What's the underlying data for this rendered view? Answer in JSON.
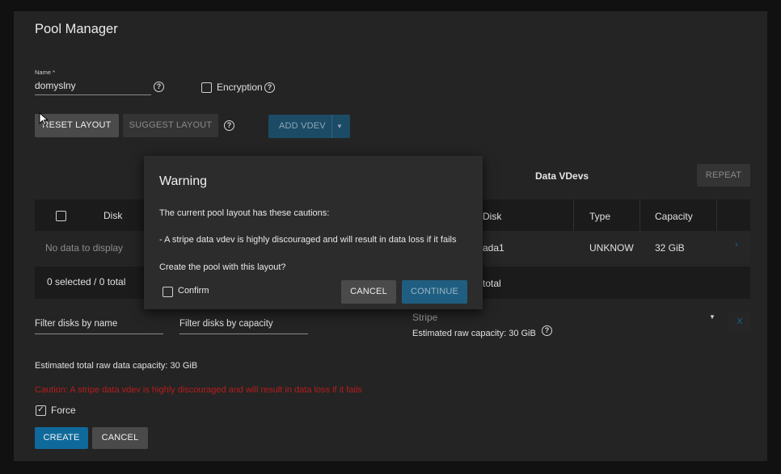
{
  "page": {
    "title": "Pool Manager"
  },
  "name_field": {
    "label": "Name *",
    "value": "domyslny"
  },
  "encryption": {
    "label": "Encryption"
  },
  "toolbar": {
    "reset_layout": "RESET LAYOUT",
    "suggest_layout": "SUGGEST LAYOUT",
    "add_vdev": "ADD VDEV"
  },
  "available_disks": {
    "column_header": "Disk",
    "empty_text": "No data to display",
    "footer": "0 selected / 0 total",
    "filter_name_placeholder": "Filter disks by name",
    "filter_capacity_placeholder": "Filter disks by capacity"
  },
  "data_vdevs": {
    "title": "Data VDevs",
    "repeat_label": "REPEAT",
    "columns": [
      "Disk",
      "Type",
      "Capacity"
    ],
    "rows": [
      {
        "disk": "ada1",
        "type": "UNKNOW",
        "capacity": "32 GiB"
      }
    ],
    "footer": "total",
    "layout_value": "Stripe",
    "estimated_capacity": "Estimated raw capacity: 30 GiB",
    "remove_label": "X"
  },
  "summary": {
    "estimated_total": "Estimated total raw data capacity: 30 GiB",
    "caution": "Caution: A stripe data vdev is highly discouraged and will result in data loss if it fails",
    "force_label": "Force",
    "force_checked": true
  },
  "actions": {
    "create": "CREATE",
    "cancel": "CANCEL"
  },
  "dialog": {
    "title": "Warning",
    "line1": "The current pool layout has these cautions:",
    "line2": "- A stripe data vdev is highly discouraged and will result in data loss if it fails",
    "line3": "Create the pool with this layout?",
    "confirm_label": "Confirm",
    "cancel": "CANCEL",
    "continue": "CONTINUE"
  },
  "colors": {
    "background": "#111111",
    "card": "#242424",
    "accent_blue": "#0f6a9b",
    "caution_red": "#b71c1c",
    "dialog": "#2c2c2c"
  }
}
